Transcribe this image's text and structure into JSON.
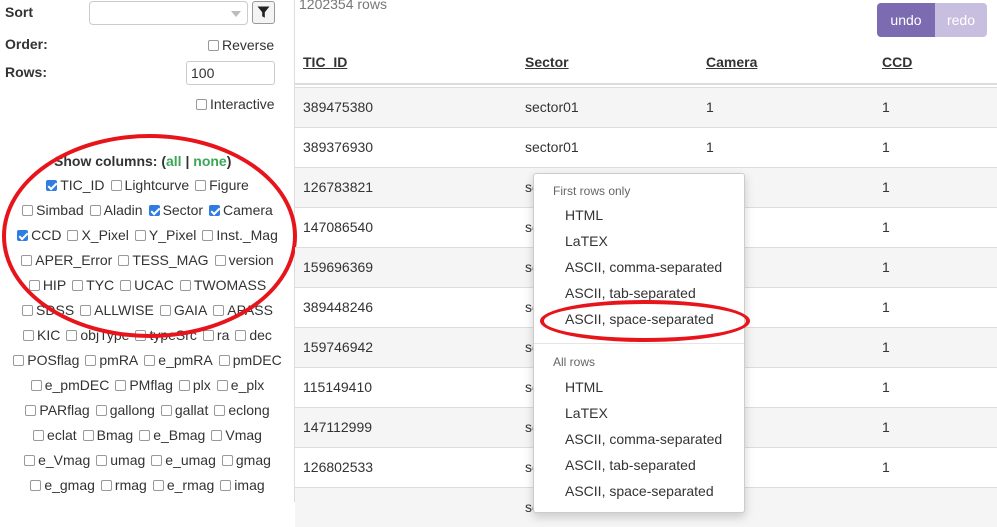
{
  "sidebar": {
    "sort_label": "Sort",
    "sort_value": "",
    "order_label": "Order:",
    "reverse_label": "Reverse",
    "reverse_checked": false,
    "rows_label": "Rows:",
    "rows_value": "100",
    "interactive_label": "Interactive",
    "interactive_checked": false,
    "show_columns_label": "Show columns: (",
    "all_link": "all",
    "sep": " | ",
    "none_link": "none",
    "close_paren": ")",
    "columns": [
      [
        "TIC_ID",
        true
      ],
      [
        "Lightcurve",
        false
      ],
      [
        "Figure",
        false
      ],
      [
        "Simbad",
        false
      ],
      [
        "Aladin",
        false
      ],
      [
        "Sector",
        true
      ],
      [
        "Camera",
        true
      ],
      [
        "CCD",
        true
      ],
      [
        "X_Pixel",
        false
      ],
      [
        "Y_Pixel",
        false
      ],
      [
        "Inst._Mag",
        false
      ],
      [
        "APER_Error",
        false
      ],
      [
        "TESS_MAG",
        false
      ],
      [
        "version",
        false
      ],
      [
        "HIP",
        false
      ],
      [
        "TYC",
        false
      ],
      [
        "UCAC",
        false
      ],
      [
        "TWOMASS",
        false
      ],
      [
        "SDSS",
        false
      ],
      [
        "ALLWISE",
        false
      ],
      [
        "GAIA",
        false
      ],
      [
        "APASS",
        false
      ],
      [
        "KIC",
        false
      ],
      [
        "objType",
        false
      ],
      [
        "typeSrc",
        false
      ],
      [
        "ra",
        false
      ],
      [
        "dec",
        false
      ],
      [
        "POSflag",
        false
      ],
      [
        "pmRA",
        false
      ],
      [
        "e_pmRA",
        false
      ],
      [
        "pmDEC",
        false
      ],
      [
        "e_pmDEC",
        false
      ],
      [
        "PMflag",
        false
      ],
      [
        "plx",
        false
      ],
      [
        "e_plx",
        false
      ],
      [
        "PARflag",
        false
      ],
      [
        "gallong",
        false
      ],
      [
        "gallat",
        false
      ],
      [
        "eclong",
        false
      ],
      [
        "eclat",
        false
      ],
      [
        "Bmag",
        false
      ],
      [
        "e_Bmag",
        false
      ],
      [
        "Vmag",
        false
      ],
      [
        "e_Vmag",
        false
      ],
      [
        "umag",
        false
      ],
      [
        "e_umag",
        false
      ],
      [
        "gmag",
        false
      ],
      [
        "e_gmag",
        false
      ],
      [
        "rmag",
        false
      ],
      [
        "e_rmag",
        false
      ],
      [
        "imag",
        false
      ]
    ]
  },
  "table": {
    "rows_count": "1202354 rows",
    "undo_label": "undo",
    "redo_label": "redo",
    "headers": [
      "TIC_ID",
      "Sector",
      "Camera",
      "CCD"
    ],
    "rows": [
      [
        "389475380",
        "sector01",
        "1",
        "1"
      ],
      [
        "389376930",
        "sector01",
        "1",
        "1"
      ],
      [
        "126783821",
        "se",
        "",
        "1"
      ],
      [
        "147086540",
        "se",
        "",
        "1"
      ],
      [
        "159696369",
        "se",
        "",
        "1"
      ],
      [
        "389448246",
        "se",
        "",
        "1"
      ],
      [
        "159746942",
        "se",
        "",
        "1"
      ],
      [
        "115149410",
        "se",
        "",
        "1"
      ],
      [
        "147112999",
        "se",
        "",
        "1"
      ],
      [
        "126802533",
        "se",
        "",
        "1"
      ],
      [
        "",
        "se",
        "",
        ""
      ]
    ]
  },
  "export_menu": {
    "first_rows_header": "First rows only",
    "first_rows_items": [
      "HTML",
      "LaTEX",
      "ASCII, comma-separated",
      "ASCII, tab-separated",
      "ASCII, space-separated"
    ],
    "all_rows_header": "All rows",
    "all_rows_items": [
      "HTML",
      "LaTEX",
      "ASCII, comma-separated",
      "ASCII, tab-separated",
      "ASCII, space-separated"
    ]
  },
  "colors": {
    "accent_link": "#3aa757",
    "undo_bg": "#7c6bb0",
    "redo_bg": "#c8bfe0",
    "annotation": "#e8141b",
    "checkbox_on": "#2f7de1"
  }
}
